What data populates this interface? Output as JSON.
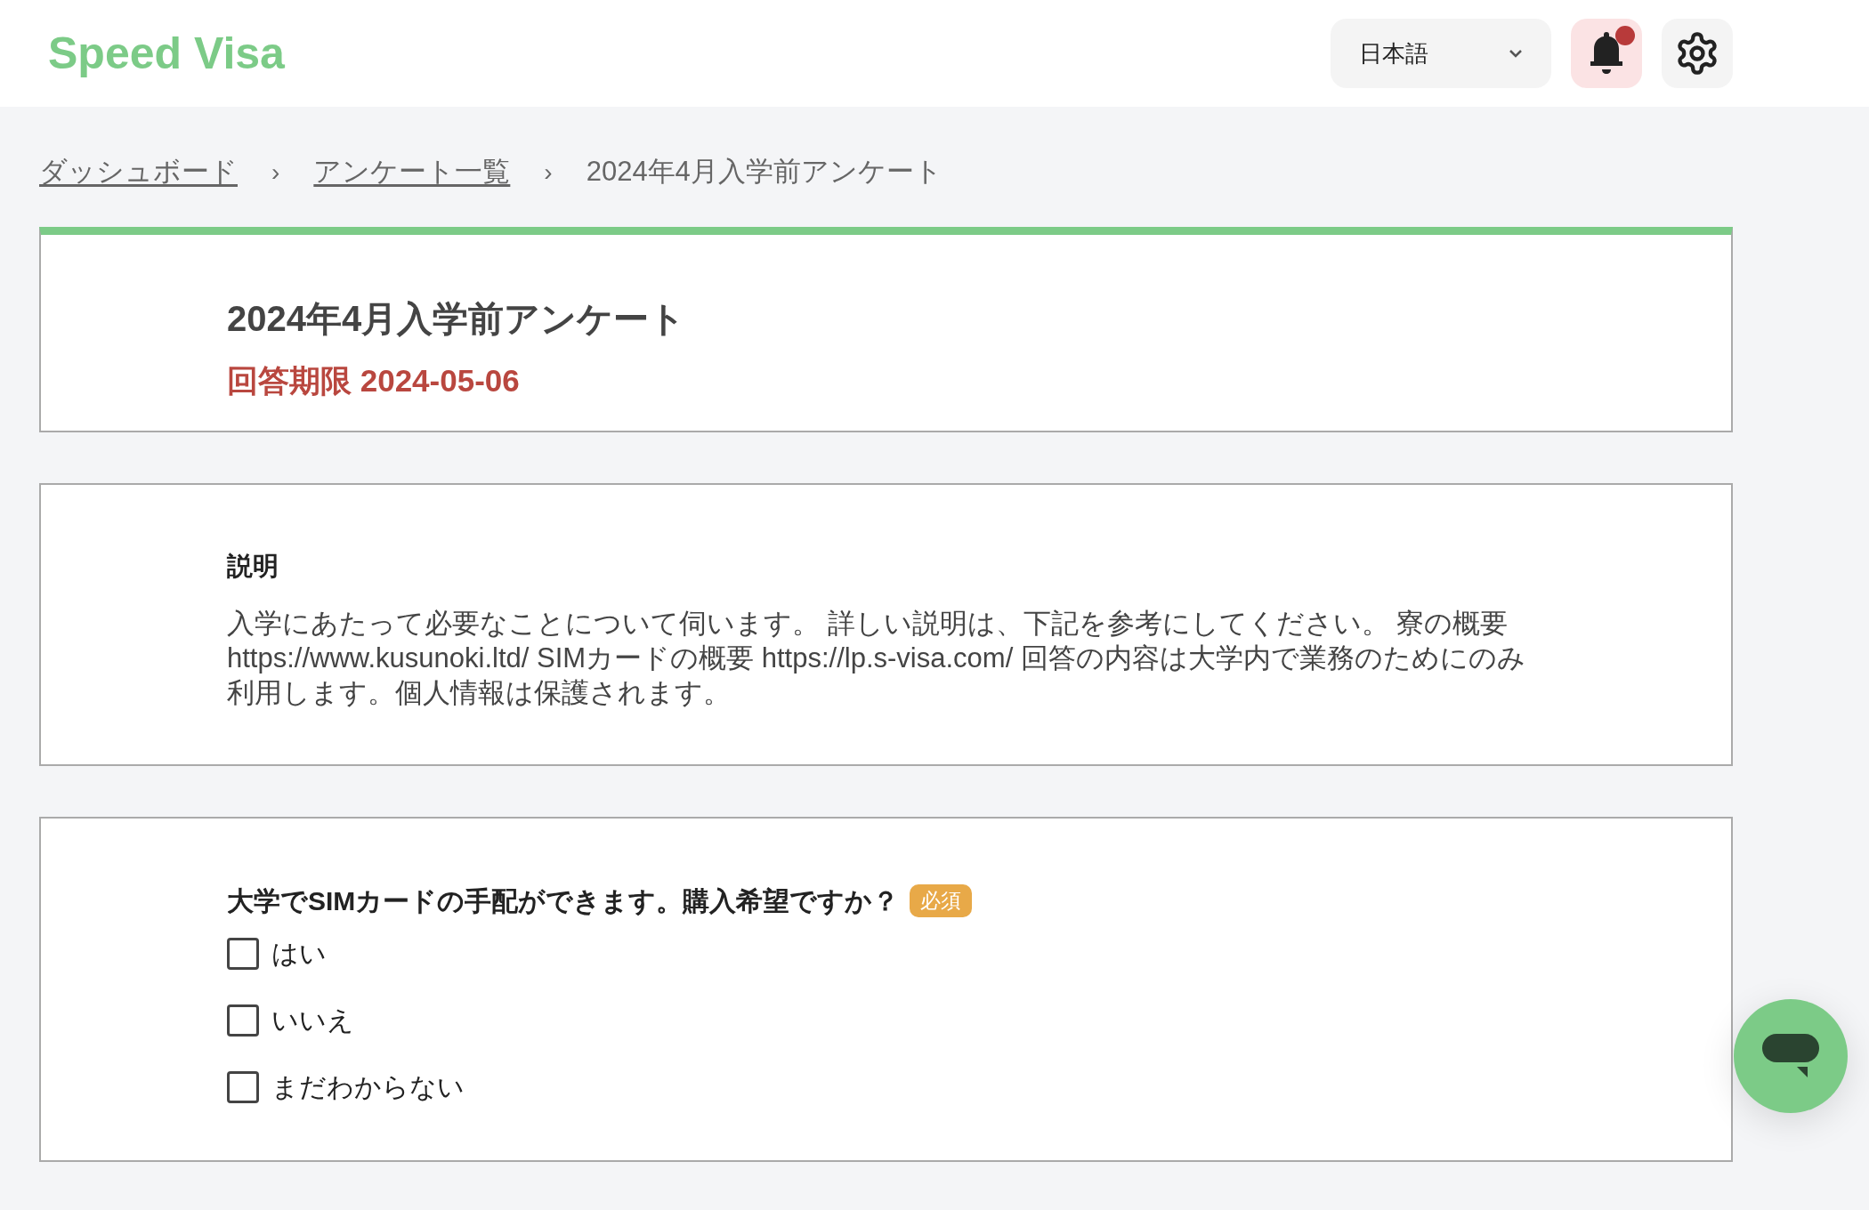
{
  "header": {
    "logo": "Speed Visa",
    "language": "日本語",
    "has_unread_notifications": true
  },
  "breadcrumb": [
    {
      "label": "ダッシュボード",
      "link": true
    },
    {
      "label": "アンケート一覧",
      "link": true
    },
    {
      "label": "2024年4月入学前アンケート",
      "link": false
    }
  ],
  "breadcrumb_separators": [
    "›",
    "›"
  ],
  "survey": {
    "title": "2024年4月入学前アンケート",
    "deadline": "回答期限 2024-05-06"
  },
  "description": {
    "heading": "説明",
    "text": "入学にあたって必要なことについて伺います。 詳しい説明は、下記を参考にしてください。 寮の概要 https://www.kusunoki.ltd/ SIMカードの概要 https://lp.s-visa.com/ 回答の内容は大学内で業務のためにのみ利用します。個人情報は保護されます。"
  },
  "question": {
    "text": "大学でSIMカードの手配ができます。購入希望ですか？",
    "required_badge": "必須",
    "options": [
      {
        "label": "はい",
        "checked": false
      },
      {
        "label": "いいえ",
        "checked": false
      },
      {
        "label": "まだわからない",
        "checked": false
      }
    ]
  }
}
